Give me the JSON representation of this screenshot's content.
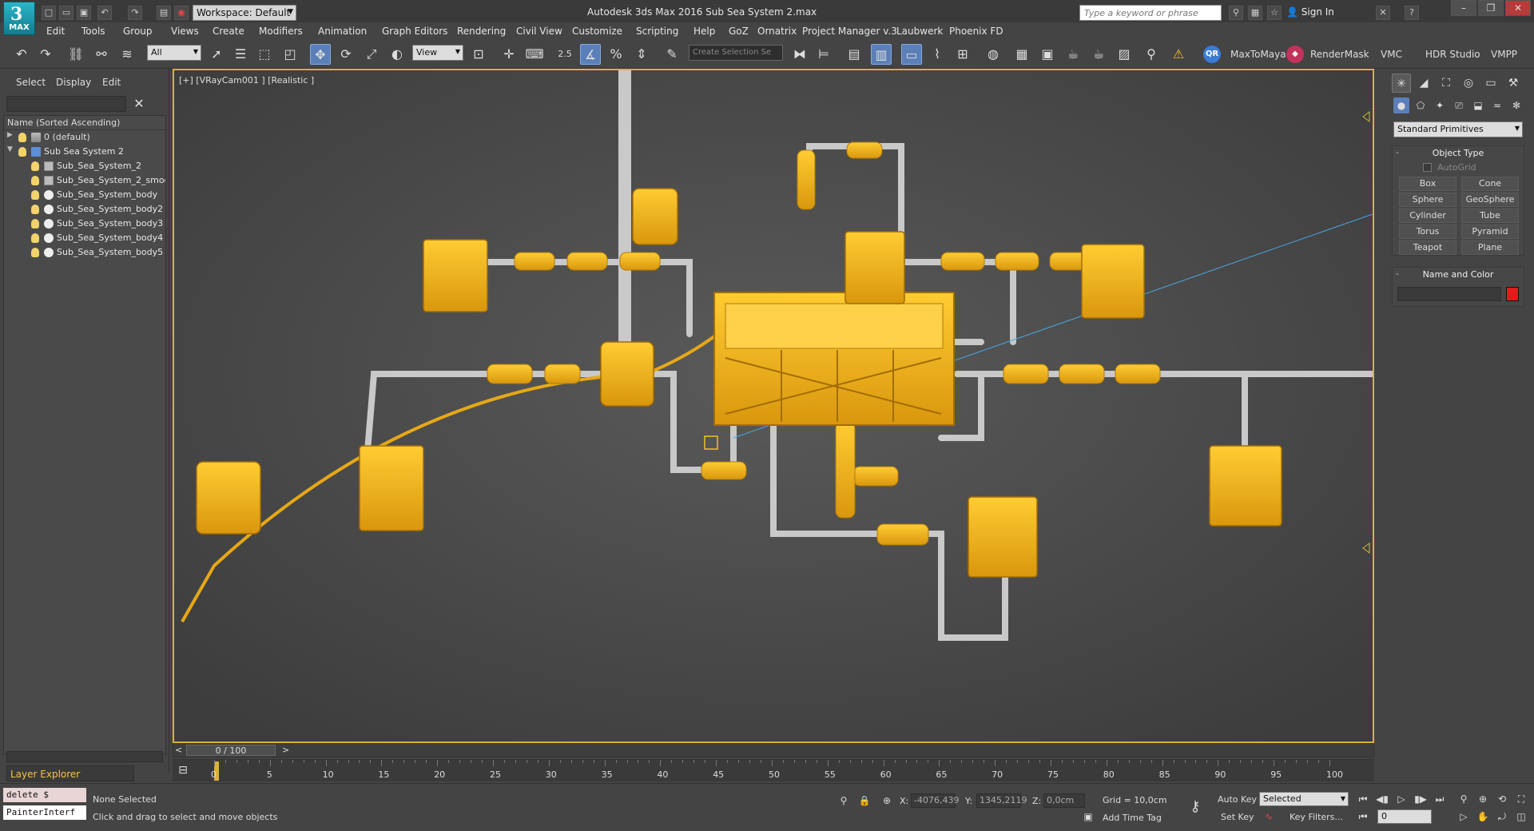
{
  "titlebar": {
    "app_short": "MAX",
    "workspace": "Workspace: Default",
    "title": "Autodesk 3ds Max 2016     Sub Sea System 2.max",
    "search_placeholder": "Type a keyword or phrase",
    "sign_in": "Sign In"
  },
  "menu": [
    "Edit",
    "Tools",
    "Group",
    "Views",
    "Create",
    "Modifiers",
    "Animation",
    "Graph Editors",
    "Rendering",
    "Civil View",
    "Customize",
    "Scripting",
    "Help",
    "GoZ",
    "Ornatrix",
    "Project Manager v.3",
    "Laubwerk",
    "Phoenix FD"
  ],
  "toolbar": {
    "selection_filter": "All",
    "ref_coord": "View",
    "snap_value": "2.5",
    "named_selection_placeholder": "Create Selection Se",
    "plugins": [
      "MaxToMaya",
      "RenderMask",
      "VMC",
      "HDR Studio",
      "VMPP"
    ]
  },
  "scene_explorer": {
    "tabs": [
      "Select",
      "Display",
      "Edit"
    ],
    "column_header": "Name (Sorted Ascending)",
    "rows": [
      {
        "label": "0 (default)",
        "kind": "layer",
        "level": 0
      },
      {
        "label": "Sub Sea System 2",
        "kind": "group",
        "level": 0
      },
      {
        "label": "Sub_Sea_System_2",
        "kind": "mesh",
        "level": 1
      },
      {
        "label": "Sub_Sea_System_2_smoo",
        "kind": "mesh",
        "level": 1
      },
      {
        "label": "Sub_Sea_System_body",
        "kind": "sphere",
        "level": 1
      },
      {
        "label": "Sub_Sea_System_body2",
        "kind": "sphere",
        "level": 1
      },
      {
        "label": "Sub_Sea_System_body3",
        "kind": "sphere",
        "level": 1
      },
      {
        "label": "Sub_Sea_System_body4",
        "kind": "sphere",
        "level": 1
      },
      {
        "label": "Sub_Sea_System_body5",
        "kind": "sphere",
        "level": 1
      }
    ],
    "explorer_mode": "Layer Explorer"
  },
  "viewport": {
    "label": "[+] [VRayCam001 ] [Realistic ]"
  },
  "command_panel": {
    "category": "Standard Primitives",
    "object_type_title": "Object Type",
    "autogrid": "AutoGrid",
    "buttons": [
      "Box",
      "Cone",
      "Sphere",
      "GeoSphere",
      "Cylinder",
      "Tube",
      "Torus",
      "Pyramid",
      "Teapot",
      "Plane"
    ],
    "name_color_title": "Name and Color",
    "object_color": "#e31b1b"
  },
  "timeline": {
    "frame_display": "0 / 100",
    "ticks": [
      "0",
      "5",
      "10",
      "15",
      "20",
      "25",
      "30",
      "35",
      "40",
      "45",
      "50",
      "55",
      "60",
      "65",
      "70",
      "75",
      "80",
      "85",
      "90",
      "95",
      "100"
    ]
  },
  "status": {
    "maxscript_line1": "delete $",
    "maxscript_line2": "PainterInterf",
    "selection": "None Selected",
    "prompt": "Click and drag to select and move objects",
    "x_label": "X:",
    "x_value": "-4076,439",
    "y_label": "Y:",
    "y_value": "1345,2119",
    "z_label": "Z:",
    "z_value": "0,0cm",
    "grid": "Grid = 10,0cm",
    "add_time_tag": "Add Time Tag",
    "auto_key": "Auto Key",
    "set_key": "Set Key",
    "key_mode": "Selected",
    "key_filters": "Key Filters...",
    "current_frame": "0"
  },
  "colors": {
    "equipment": "#f2b21b",
    "pipe": "#c8c8c8",
    "viewport_bg": "#505050",
    "accent_active": "#5b7fb8"
  }
}
